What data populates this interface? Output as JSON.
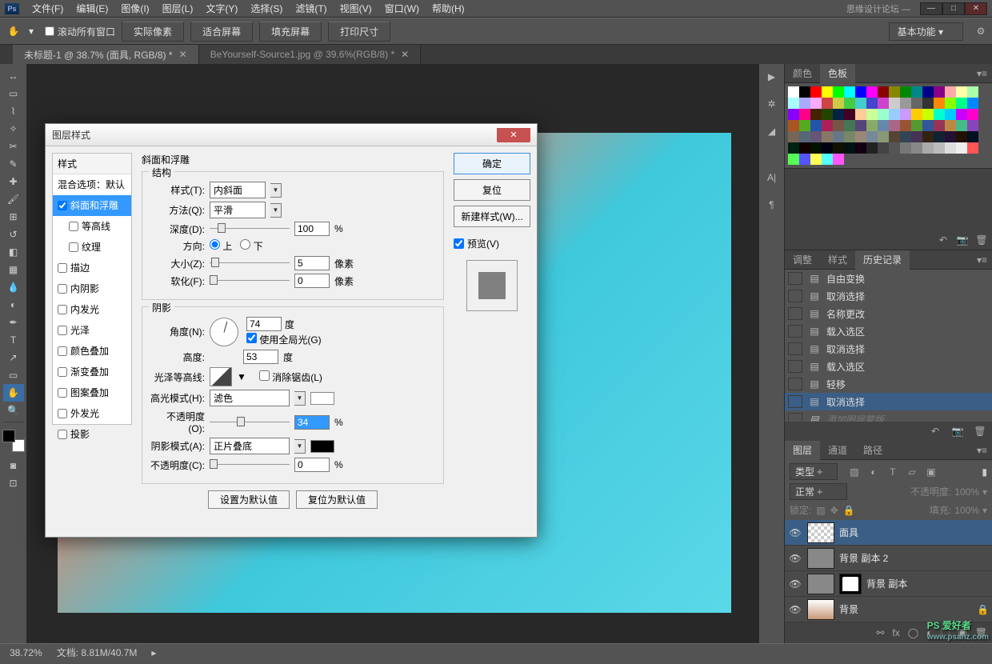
{
  "menu": {
    "file": "文件(F)",
    "edit": "编辑(E)",
    "image": "图像(I)",
    "layer": "图层(L)",
    "type": "文字(Y)",
    "select": "选择(S)",
    "filter": "滤镜(T)",
    "view": "视图(V)",
    "window": "窗口(W)",
    "help": "帮助(H)"
  },
  "title_ext": "思缘设计论坛  —",
  "options": {
    "scroll_all": "滚动所有窗口",
    "actual": "实际像素",
    "fit": "适合屏幕",
    "fill": "填充屏幕",
    "print": "打印尺寸",
    "workspace": "基本功能"
  },
  "tabs": {
    "t1": "未标题-1 @ 38.7% (面具, RGB/8) *",
    "t2": "BeYourself-Source1.jpg @ 39.6%(RGB/8) *"
  },
  "panel": {
    "color": "颜色",
    "swatches": "色板",
    "adjust": "调整",
    "styles": "样式",
    "history": "历史记录",
    "layers": "图层",
    "channels": "通道",
    "paths": "路径"
  },
  "history": {
    "h0": "自由变换",
    "h1": "取消选择",
    "h2": "名称更改",
    "h3": "载入选区",
    "h4": "取消选择",
    "h5": "载入选区",
    "h6": "轻移",
    "h7": "取消选择",
    "h8": "添加图层蒙版"
  },
  "layer_opts": {
    "kind": "类型",
    "blend": "正常",
    "opacity_label": "不透明度:",
    "opacity": "100%",
    "lock": "锁定:",
    "fill_label": "填充:",
    "fill": "100%"
  },
  "layers": {
    "l0": "面具",
    "l1": "背景 副本 2",
    "l2": "背景 副本",
    "l3": "背景"
  },
  "status": {
    "zoom": "38.72%",
    "doc": "文档: 8.81M/40.7M"
  },
  "dialog": {
    "title": "图层样式",
    "styles_hdr": "样式",
    "blend_opts": "混合选项：默认",
    "bevel": "斜面和浮雕",
    "contour": "等高线",
    "texture": "纹理",
    "stroke": "描边",
    "inner_shadow": "内阴影",
    "inner_glow": "内发光",
    "satin": "光泽",
    "color_overlay": "颜色叠加",
    "grad_overlay": "渐变叠加",
    "pattern_overlay": "图案叠加",
    "outer_glow": "外发光",
    "drop_shadow": "投影",
    "sect_bevel": "斜面和浮雕",
    "sect_struct": "结构",
    "sect_shade": "阴影",
    "f_style": "样式(T):",
    "v_style": "内斜面",
    "f_tech": "方法(Q):",
    "v_tech": "平滑",
    "f_depth": "深度(D):",
    "v_depth": "100",
    "u_pct": "%",
    "f_dir": "方向:",
    "dir_up": "上",
    "dir_down": "下",
    "f_size": "大小(Z):",
    "v_size": "5",
    "u_px": "像素",
    "f_soften": "软化(F):",
    "v_soften": "0",
    "f_angle": "角度(N):",
    "v_angle": "74",
    "u_deg": "度",
    "global": "使用全局光(G)",
    "f_alt": "高度:",
    "v_alt": "53",
    "f_gloss": "光泽等高线:",
    "anti": "消除锯齿(L)",
    "f_hmode": "高光模式(H):",
    "v_hmode": "滤色",
    "f_hopac": "不透明度(O):",
    "v_hopac": "34",
    "f_smode": "阴影模式(A):",
    "v_smode": "正片叠底",
    "f_sopac": "不透明度(C):",
    "v_sopac": "0",
    "btn_default": "设置为默认值",
    "btn_reset": "复位为默认值",
    "ok": "确定",
    "cancel": "复位",
    "new_style": "新建样式(W)...",
    "preview": "预览(V)"
  },
  "watermark": {
    "main": "PS 爱好者",
    "sub": "www.psahz.com"
  }
}
